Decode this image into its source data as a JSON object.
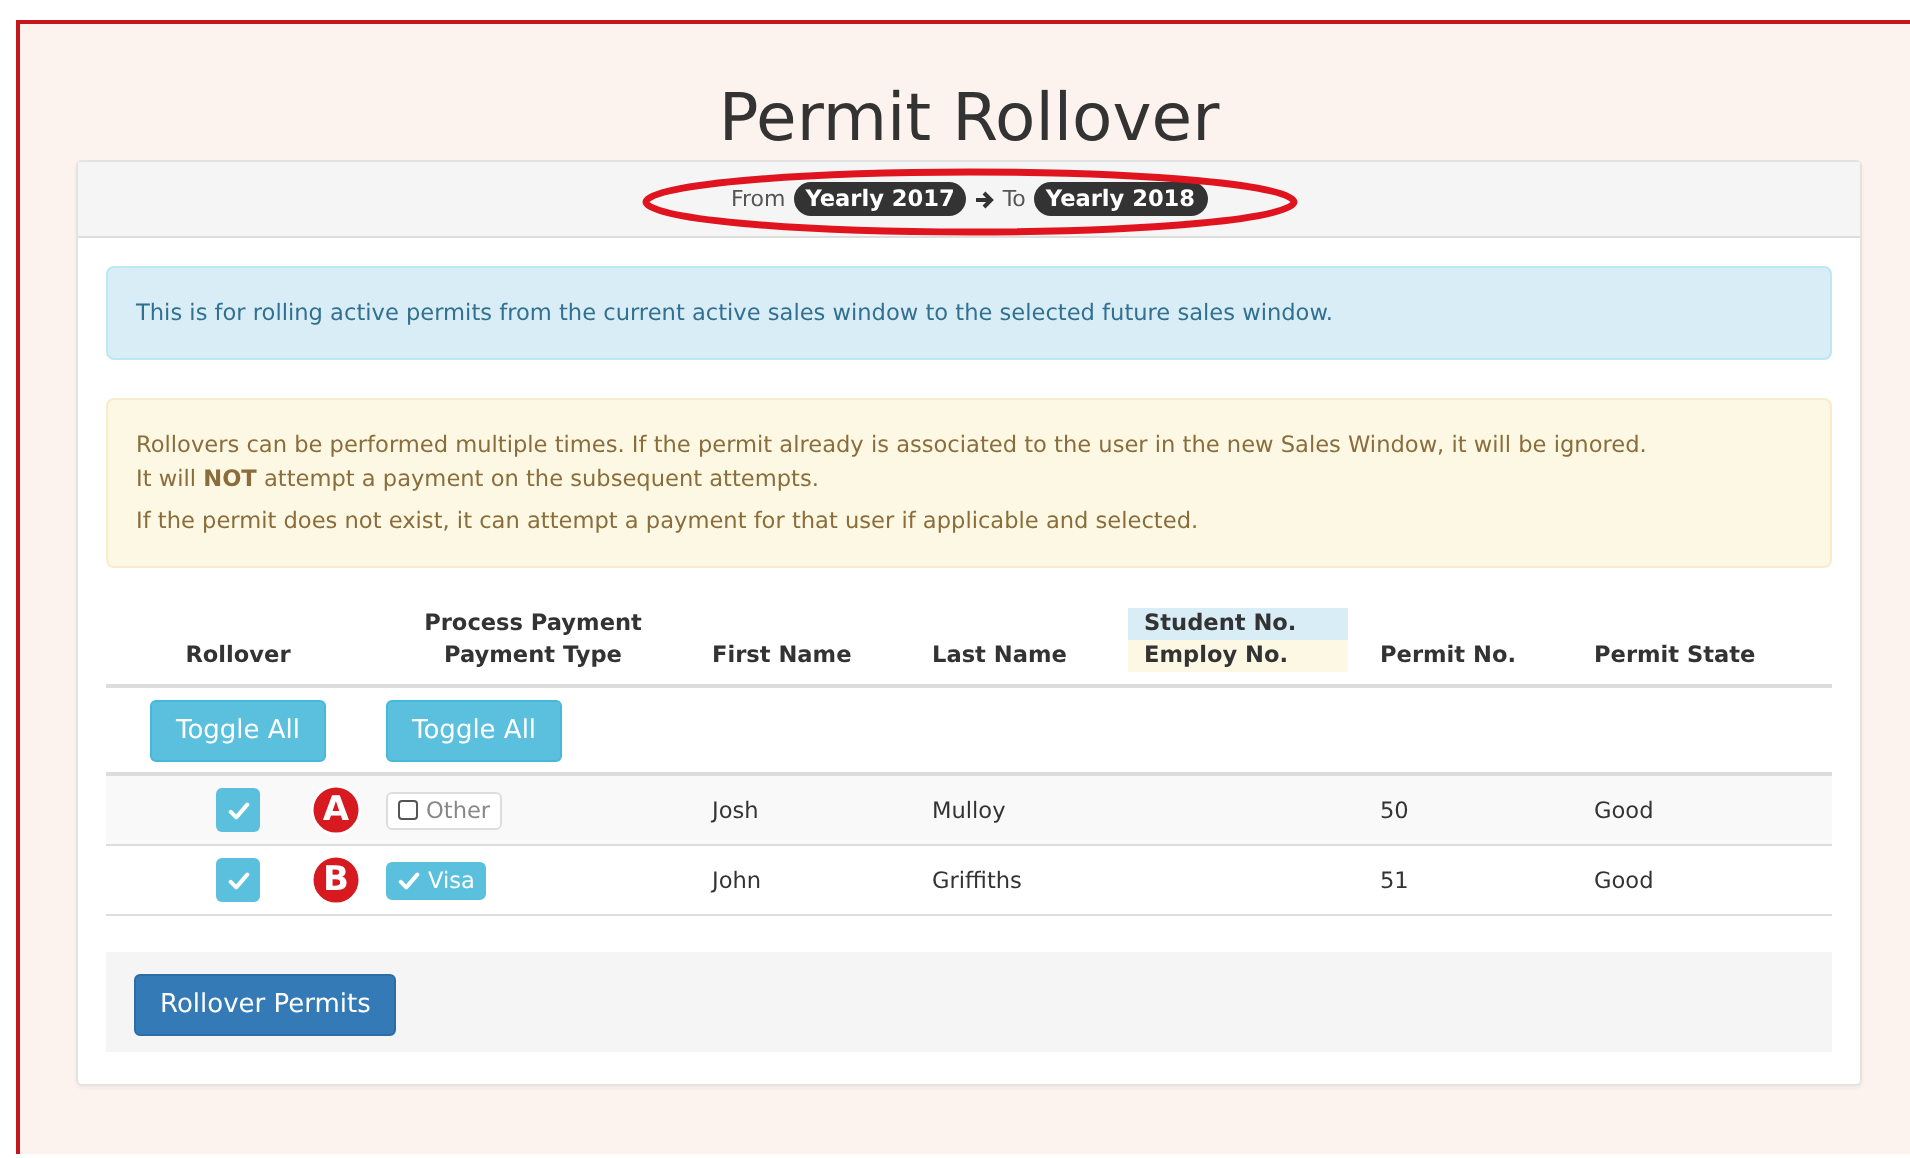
{
  "title": "Permit Rollover",
  "heading": {
    "from_label": "From",
    "from": "Yearly 2017",
    "to_label": "To",
    "to": "Yearly 2018"
  },
  "alerts": [
    {
      "kind": "info",
      "paragraphs": [
        [
          "This is for rolling active permits from the current active sales window to the selected future sales window."
        ]
      ]
    },
    {
      "kind": "warning",
      "paragraphs": [
        [
          "Rollovers can be performed multiple times. If the permit already is associated to the user in the new Sales Window, it will be ignored.",
          "It will **NOT** attempt a payment on the subsequent attempts."
        ],
        [
          "If the permit does not exist, it can attempt a payment for that user if applicable and selected."
        ]
      ]
    }
  ],
  "table": {
    "columns": [
      {
        "lines": [
          {
            "text": "Rollover"
          }
        ]
      },
      {
        "lines": [
          {
            "text": "Process Payment"
          },
          {
            "text": "Payment Type"
          }
        ]
      },
      {
        "lines": [
          {
            "text": "First Name"
          }
        ]
      },
      {
        "lines": [
          {
            "text": "Last Name"
          }
        ]
      },
      {
        "lines": [
          {
            "text": "Student No.",
            "color": "#d9edf7"
          },
          {
            "text": "Employ No.",
            "color": "#fcf8e3"
          }
        ]
      },
      {
        "lines": [
          {
            "text": "Permit No."
          }
        ]
      },
      {
        "lines": [
          {
            "text": "Permit State"
          }
        ]
      }
    ],
    "toggle_buttons": [
      "Toggle All",
      "Toggle All"
    ],
    "rows": [
      {
        "rollover_checked": true,
        "marker": "A",
        "payment_type": "Other",
        "payment_selected": false,
        "first_name": "Josh",
        "last_name": "Mulloy",
        "permit_no": "50",
        "permit_state": "Good"
      },
      {
        "rollover_checked": true,
        "marker": "B",
        "payment_type": "Visa",
        "payment_selected": true,
        "first_name": "John",
        "last_name": "Griffiths",
        "permit_no": "51",
        "permit_state": "Good"
      }
    ]
  },
  "submit": "Rollover Permits"
}
